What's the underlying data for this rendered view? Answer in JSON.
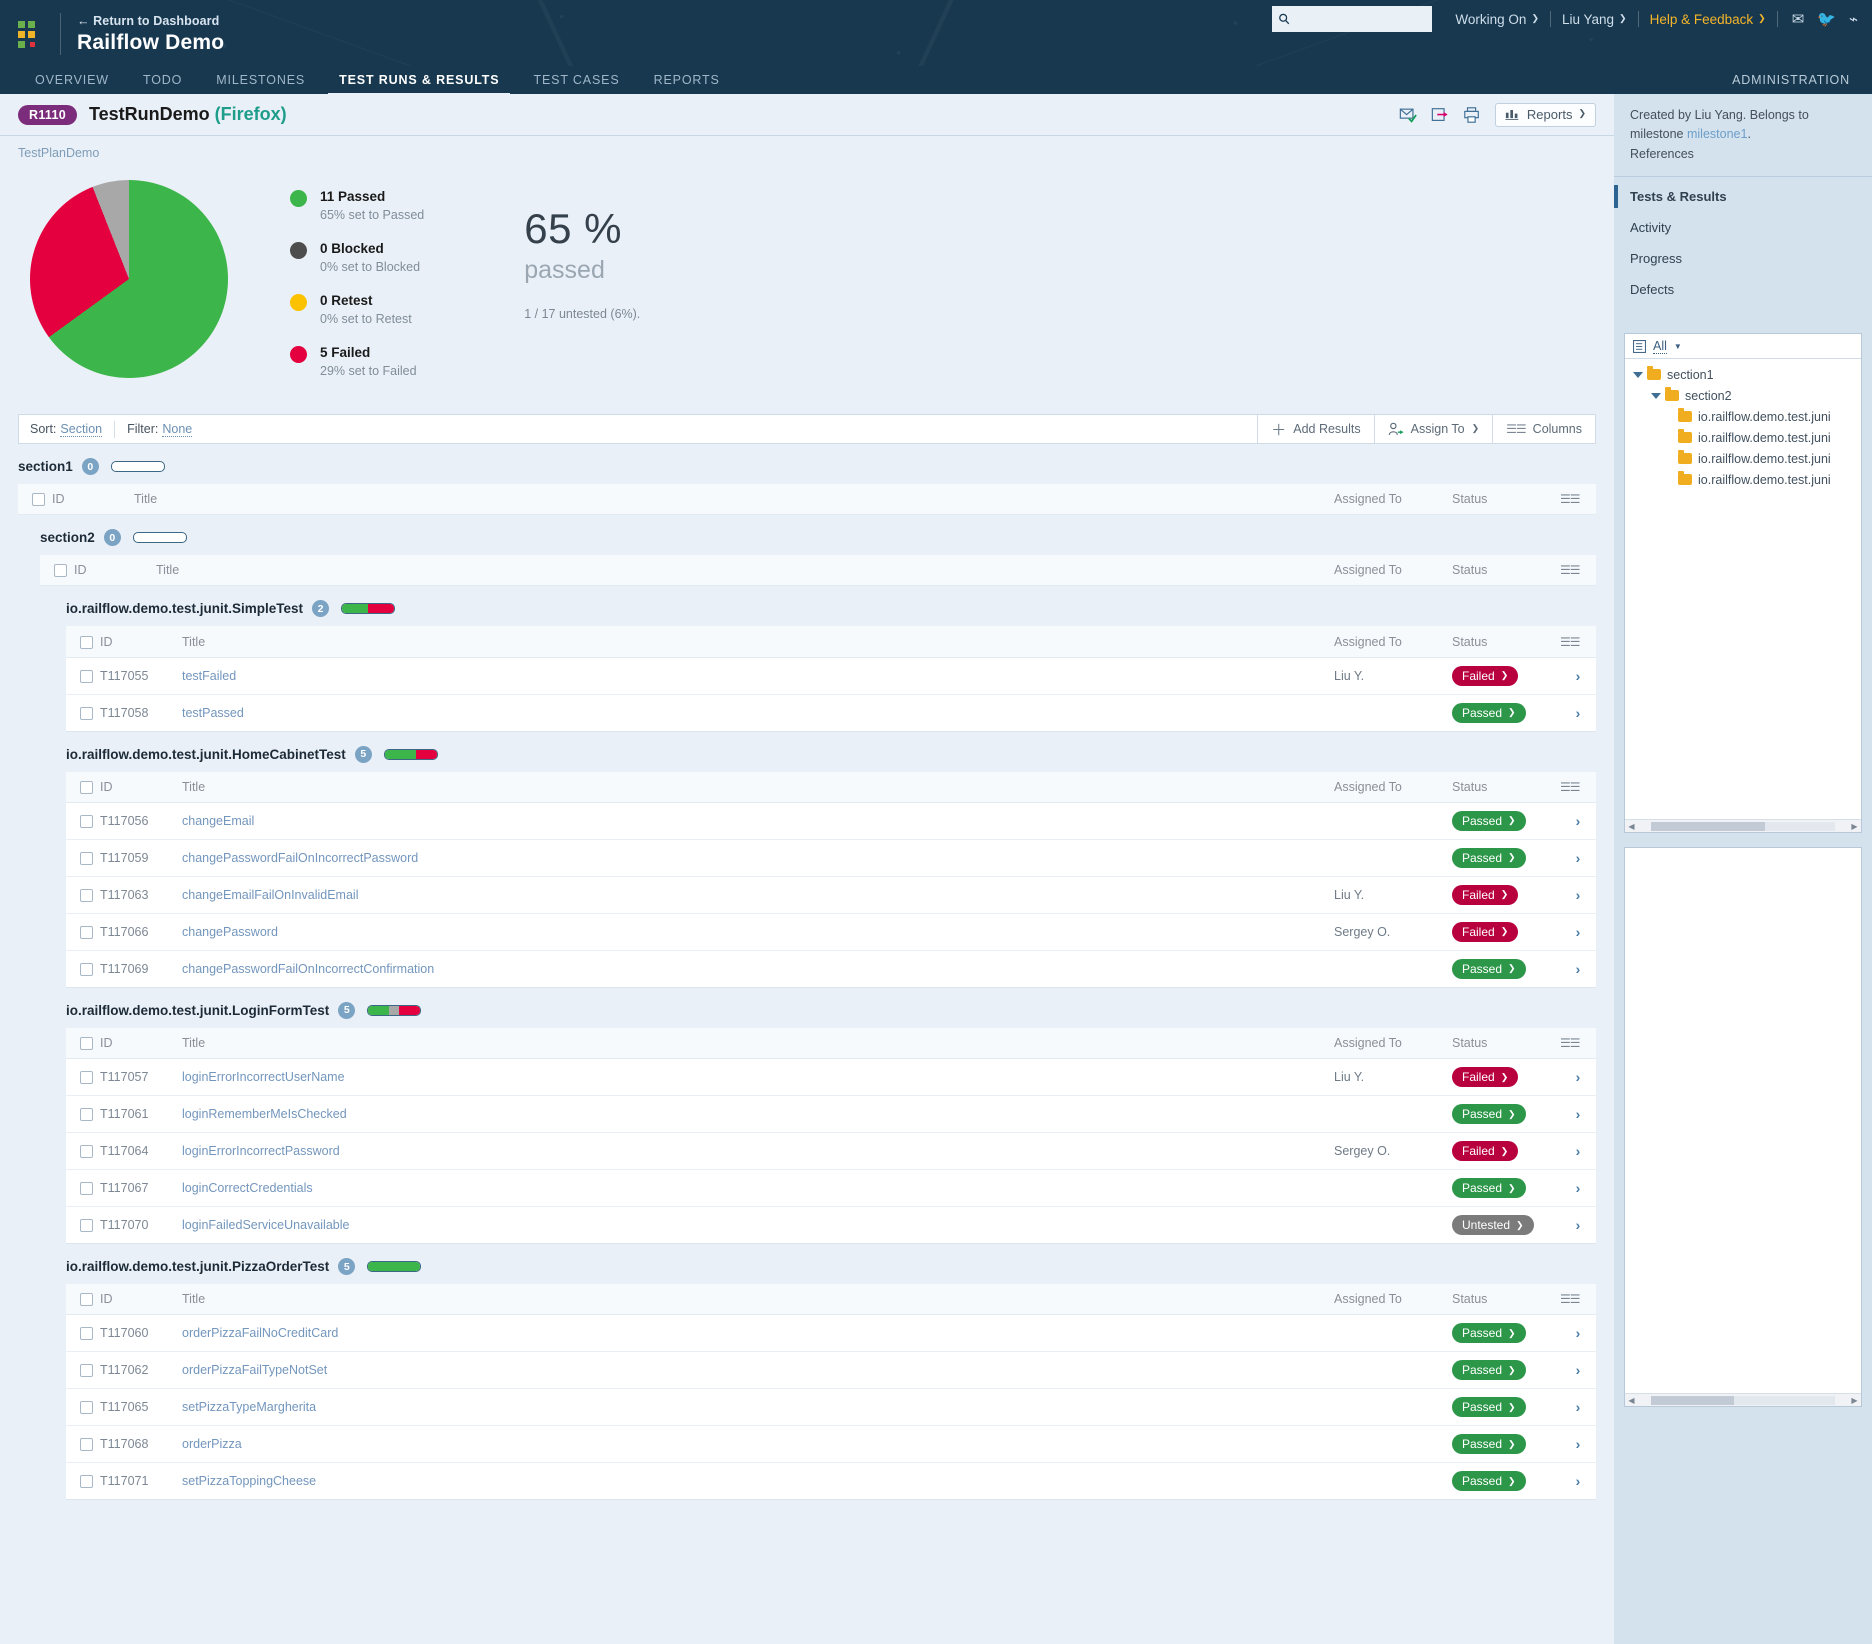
{
  "topbar": {
    "return_label": "← Return to Dashboard",
    "brand": "Railflow Demo",
    "search_placeholder": "",
    "search_value": "",
    "working_on": "Working On",
    "user": "Liu Yang",
    "help": "Help & Feedback",
    "icons": [
      "envelope-icon",
      "twitter-icon",
      "rss-icon"
    ]
  },
  "nav": {
    "tabs": [
      {
        "label": "OVERVIEW",
        "active": false
      },
      {
        "label": "TODO",
        "active": false
      },
      {
        "label": "MILESTONES",
        "active": false
      },
      {
        "label": "TEST RUNS & RESULTS",
        "active": true
      },
      {
        "label": "TEST CASES",
        "active": false
      },
      {
        "label": "REPORTS",
        "active": false
      }
    ],
    "admin": "ADMINISTRATION"
  },
  "run": {
    "id": "R1110",
    "title": "TestRunDemo",
    "environment": "(Firefox)",
    "breadcrumb": "TestPlanDemo",
    "reports_label": "Reports",
    "tool_icons": [
      "email-sent-icon",
      "export-icon",
      "print-icon",
      "chart-icon"
    ]
  },
  "chart_data": {
    "type": "pie",
    "title": "Test run results",
    "categories": [
      "Passed",
      "Blocked",
      "Retest",
      "Failed",
      "Untested"
    ],
    "values": [
      11,
      0,
      0,
      5,
      1
    ],
    "percents": [
      65,
      0,
      0,
      29,
      6
    ],
    "colors": [
      "#3cb54a",
      "#4d4d4d",
      "#fcc200",
      "#e4003f",
      "#a8a8a8"
    ],
    "legend_position": "right",
    "legend": [
      {
        "count": "11 Passed",
        "detail": "65% set to Passed",
        "color": "#3cb54a"
      },
      {
        "count": "0 Blocked",
        "detail": "0% set to Blocked",
        "color": "#4d4d4d"
      },
      {
        "count": "0 Retest",
        "detail": "0% set to Retest",
        "color": "#fcc200"
      },
      {
        "count": "5 Failed",
        "detail": "29% set to Failed",
        "color": "#e4003f"
      }
    ],
    "headline_number": "65 %",
    "headline_word": "passed",
    "headline_note": "1 / 17 untested (6%)."
  },
  "toolbar": {
    "sort_label": "Sort:",
    "sort_value": "Section",
    "filter_label": "Filter:",
    "filter_value": "None",
    "add_results": "Add Results",
    "assign_to": "Assign To",
    "columns": "Columns"
  },
  "columns": {
    "id": "ID",
    "title": "Title",
    "assigned": "Assigned To",
    "status": "Status"
  },
  "sections": [
    {
      "name": "section1",
      "count": "0",
      "bar": []
    },
    {
      "name": "section2",
      "count": "0",
      "bar": []
    }
  ],
  "groups": [
    {
      "name": "io.railflow.demo.test.junit.SimpleTest",
      "count": "2",
      "bar": [
        {
          "color": "#3cb54a",
          "pct": 50
        },
        {
          "color": "#e4003f",
          "pct": 50
        }
      ],
      "rows": [
        {
          "id": "T117055",
          "title": "testFailed",
          "assigned": "Liu Y.",
          "status": "Failed"
        },
        {
          "id": "T117058",
          "title": "testPassed",
          "assigned": "",
          "status": "Passed"
        }
      ]
    },
    {
      "name": "io.railflow.demo.test.junit.HomeCabinetTest",
      "count": "5",
      "bar": [
        {
          "color": "#3cb54a",
          "pct": 60
        },
        {
          "color": "#e4003f",
          "pct": 40
        }
      ],
      "rows": [
        {
          "id": "T117056",
          "title": "changeEmail",
          "assigned": "",
          "status": "Passed"
        },
        {
          "id": "T117059",
          "title": "changePasswordFailOnIncorrectPassword",
          "assigned": "",
          "status": "Passed"
        },
        {
          "id": "T117063",
          "title": "changeEmailFailOnInvalidEmail",
          "assigned": "Liu Y.",
          "status": "Failed"
        },
        {
          "id": "T117066",
          "title": "changePassword",
          "assigned": "Sergey O.",
          "status": "Failed"
        },
        {
          "id": "T117069",
          "title": "changePasswordFailOnIncorrectConfirmation",
          "assigned": "",
          "status": "Passed"
        }
      ]
    },
    {
      "name": "io.railflow.demo.test.junit.LoginFormTest",
      "count": "5",
      "bar": [
        {
          "color": "#3cb54a",
          "pct": 40
        },
        {
          "color": "#a8a8a8",
          "pct": 20
        },
        {
          "color": "#e4003f",
          "pct": 40
        }
      ],
      "rows": [
        {
          "id": "T117057",
          "title": "loginErrorIncorrectUserName",
          "assigned": "Liu Y.",
          "status": "Failed"
        },
        {
          "id": "T117061",
          "title": "loginRememberMeIsChecked",
          "assigned": "",
          "status": "Passed"
        },
        {
          "id": "T117064",
          "title": "loginErrorIncorrectPassword",
          "assigned": "Sergey O.",
          "status": "Failed"
        },
        {
          "id": "T117067",
          "title": "loginCorrectCredentials",
          "assigned": "",
          "status": "Passed"
        },
        {
          "id": "T117070",
          "title": "loginFailedServiceUnavailable",
          "assigned": "",
          "status": "Untested"
        }
      ]
    },
    {
      "name": "io.railflow.demo.test.junit.PizzaOrderTest",
      "count": "5",
      "bar": [
        {
          "color": "#3cb54a",
          "pct": 100
        }
      ],
      "rows": [
        {
          "id": "T117060",
          "title": "orderPizzaFailNoCreditCard",
          "assigned": "",
          "status": "Passed"
        },
        {
          "id": "T117062",
          "title": "orderPizzaFailTypeNotSet",
          "assigned": "",
          "status": "Passed"
        },
        {
          "id": "T117065",
          "title": "setPizzaTypeMargherita",
          "assigned": "",
          "status": "Passed"
        },
        {
          "id": "T117068",
          "title": "orderPizza",
          "assigned": "",
          "status": "Passed"
        },
        {
          "id": "T117071",
          "title": "setPizzaToppingCheese",
          "assigned": "",
          "status": "Passed"
        }
      ]
    }
  ],
  "sidebar": {
    "meta_line1": "Created by Liu Yang. Belongs to",
    "meta_line2_pre": "milestone ",
    "meta_milestone": "milestone1",
    "meta_line2_post": ".",
    "meta_line3": "References",
    "nav": [
      {
        "label": "Tests & Results",
        "active": true
      },
      {
        "label": "Activity",
        "active": false
      },
      {
        "label": "Progress",
        "active": false
      },
      {
        "label": "Defects",
        "active": false
      }
    ],
    "tree_header": "All",
    "tree": [
      {
        "label": "section1",
        "depth": 0,
        "expanded": true
      },
      {
        "label": "section2",
        "depth": 1,
        "expanded": true
      },
      {
        "label": "io.railflow.demo.test.juni",
        "depth": 2,
        "expanded": false
      },
      {
        "label": "io.railflow.demo.test.juni",
        "depth": 2,
        "expanded": false
      },
      {
        "label": "io.railflow.demo.test.juni",
        "depth": 2,
        "expanded": false
      },
      {
        "label": "io.railflow.demo.test.juni",
        "depth": 2,
        "expanded": false
      }
    ]
  }
}
